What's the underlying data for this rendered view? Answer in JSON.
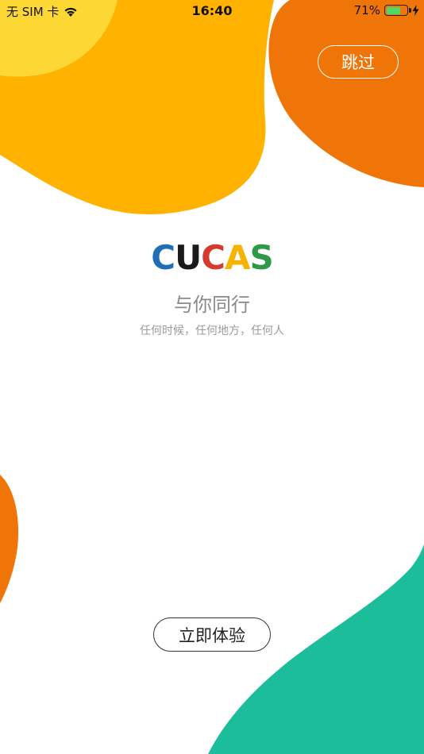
{
  "status_bar": {
    "carrier": "无 SIM 卡",
    "time": "16:40",
    "battery_percent": "71%",
    "battery_level": 0.71,
    "icons": [
      "wifi-icon",
      "battery-icon",
      "charging-bolt-icon"
    ]
  },
  "skip": {
    "label": "跳过"
  },
  "logo": {
    "letters": [
      {
        "char": "C",
        "color": "#1f6fb8"
      },
      {
        "char": "U",
        "color": "#1a1a1a"
      },
      {
        "char": "C",
        "color": "#d63a2f"
      },
      {
        "char": "A",
        "color": "#f4b400"
      },
      {
        "char": "S",
        "color": "#2e9a48"
      }
    ]
  },
  "slogan": "与你同行",
  "subslogan": "任何时候，任何地方，任何人",
  "start": {
    "label": "立即体验"
  },
  "colors": {
    "yellow_light": "#fdd835",
    "yellow": "#ffb300",
    "orange": "#f07508",
    "teal": "#1bbd9a"
  }
}
